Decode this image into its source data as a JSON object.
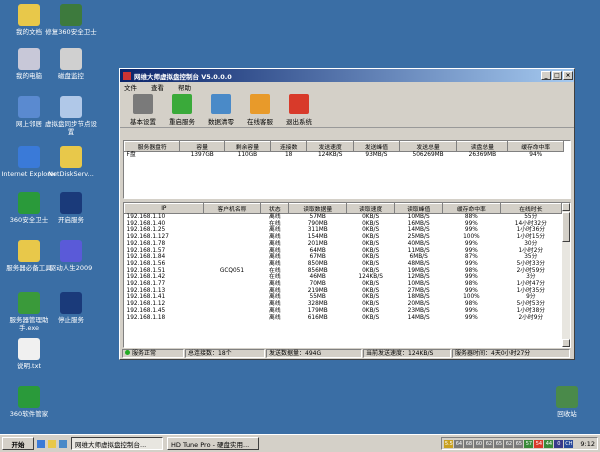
{
  "desktop_icons": [
    {
      "label": "我的文档",
      "color": "#e8c84a"
    },
    {
      "label": "修复360安全卫士",
      "color": "#3d7a3d"
    },
    {
      "label": "我的电脑",
      "color": "#c8c8d8"
    },
    {
      "label": "磁盘监控",
      "color": "#d0d0d0"
    },
    {
      "label": "网上邻居",
      "color": "#5a8ad0"
    },
    {
      "label": "虚拟盘同步节点设置",
      "color": "#b0c8e8"
    },
    {
      "label": "Internet Explorer",
      "color": "#3a7ad8"
    },
    {
      "label": "NetDiskServ...",
      "color": "#e8c84a"
    },
    {
      "label": "360安全卫士",
      "color": "#2a9a3a"
    },
    {
      "label": "开启服务",
      "color": "#1a3a7a"
    },
    {
      "label": "服务器必备工具",
      "color": "#e8c84a"
    },
    {
      "label": "驱动人生2009",
      "color": "#5a5ad8"
    },
    {
      "label": "服务器管理助手.exe",
      "color": "#3a9a3a"
    },
    {
      "label": "停止服务",
      "color": "#1a3a7a"
    },
    {
      "label": "说明.txt",
      "color": "#f0f0f0"
    },
    {
      "label": "360软件管家",
      "color": "#2a9a3a"
    },
    {
      "label": "回收站",
      "color": "#4a8a4a"
    }
  ],
  "window": {
    "title": "网维大师虚拟盘控制台 V5.0.0.0",
    "menu": [
      "文件",
      "查看",
      "帮助"
    ],
    "toolbar": [
      {
        "label": "基本设置",
        "icon": "tools-icon",
        "color": "#7a7a7a"
      },
      {
        "label": "重启服务",
        "icon": "restart-icon",
        "color": "#3aaa3a"
      },
      {
        "label": "数据清零",
        "icon": "clear-data-icon",
        "color": "#4a8ac8"
      },
      {
        "label": "在线客服",
        "icon": "support-icon",
        "color": "#e89a2a"
      },
      {
        "label": "退出系统",
        "icon": "exit-icon",
        "color": "#d83a2a"
      }
    ],
    "disk_table": {
      "headers": [
        "服务器盘符",
        "容量",
        "剩余容量",
        "连接数",
        "发送速度",
        "发送峰值",
        "发送总量",
        "读盘总量",
        "缓存命中率"
      ],
      "rows": [
        [
          "F盘",
          "1397GB",
          "110GB",
          "18",
          "124KB/S",
          "93MB/S",
          "506269MB",
          "26369MB",
          "94%"
        ]
      ]
    },
    "client_table": {
      "headers": [
        "IP",
        "客户机名称",
        "状态",
        "读取数据量",
        "读取速度",
        "读取峰值",
        "缓存命中率",
        "在线时长"
      ],
      "rows": [
        [
          "192.168.1.10",
          "",
          "离线",
          "57MB",
          "0KB/S",
          "10MB/S",
          "88%",
          "55分"
        ],
        [
          "192.168.1.40",
          "",
          "在线",
          "790MB",
          "0KB/S",
          "16MB/S",
          "99%",
          "14小时32分"
        ],
        [
          "192.168.1.25",
          "",
          "离线",
          "311MB",
          "0KB/S",
          "14MB/S",
          "99%",
          "1小时36分"
        ],
        [
          "192.168.1.127",
          "",
          "离线",
          "154MB",
          "0KB/S",
          "25MB/S",
          "100%",
          "1小时15分"
        ],
        [
          "192.168.1.78",
          "",
          "离线",
          "201MB",
          "0KB/S",
          "40MB/S",
          "99%",
          "30分"
        ],
        [
          "192.168.1.57",
          "",
          "离线",
          "64MB",
          "0KB/S",
          "11MB/S",
          "99%",
          "1小时2分"
        ],
        [
          "192.168.1.84",
          "",
          "离线",
          "67MB",
          "0KB/S",
          "6MB/S",
          "87%",
          "35分"
        ],
        [
          "192.168.1.56",
          "",
          "离线",
          "850MB",
          "0KB/S",
          "48MB/S",
          "99%",
          "5小时33分"
        ],
        [
          "192.168.1.51",
          "GCQ051",
          "在线",
          "856MB",
          "0KB/S",
          "19MB/S",
          "98%",
          "2小时59分"
        ],
        [
          "192.168.1.42",
          "",
          "在线",
          "46MB",
          "124KB/S",
          "12MB/S",
          "99%",
          "3分"
        ],
        [
          "192.168.1.77",
          "",
          "离线",
          "70MB",
          "0KB/S",
          "10MB/S",
          "98%",
          "1小时47分"
        ],
        [
          "192.168.1.13",
          "",
          "离线",
          "219MB",
          "0KB/S",
          "27MB/S",
          "99%",
          "1小时35分"
        ],
        [
          "192.168.1.41",
          "",
          "离线",
          "55MB",
          "0KB/S",
          "18MB/S",
          "100%",
          "9分"
        ],
        [
          "192.168.1.12",
          "",
          "离线",
          "328MB",
          "0KB/S",
          "20MB/S",
          "98%",
          "5小时53分"
        ],
        [
          "192.168.1.45",
          "",
          "离线",
          "179MB",
          "0KB/S",
          "23MB/S",
          "99%",
          "1小时38分"
        ],
        [
          "192.168.1.18",
          "",
          "离线",
          "616MB",
          "0KB/S",
          "14MB/S",
          "99%",
          "2小时9分"
        ]
      ]
    },
    "status": {
      "service": "服务正常",
      "connections": "总连接数：18个",
      "sent": "发送数据量：494G",
      "speed": "当前发送速度：124KB/S",
      "uptime": "服务器时间：4天0小时27分"
    }
  },
  "taskbar": {
    "start": "开始",
    "tasks": [
      "网维大师虚拟盘控制台...",
      "HD Tune Pro - 硬盘实用..."
    ],
    "tray_icons": [
      "5.5",
      "64",
      "68",
      "60",
      "62",
      "65",
      "62",
      "65",
      "57",
      "54",
      "44",
      "0",
      "CH"
    ],
    "clock": "9:12"
  }
}
